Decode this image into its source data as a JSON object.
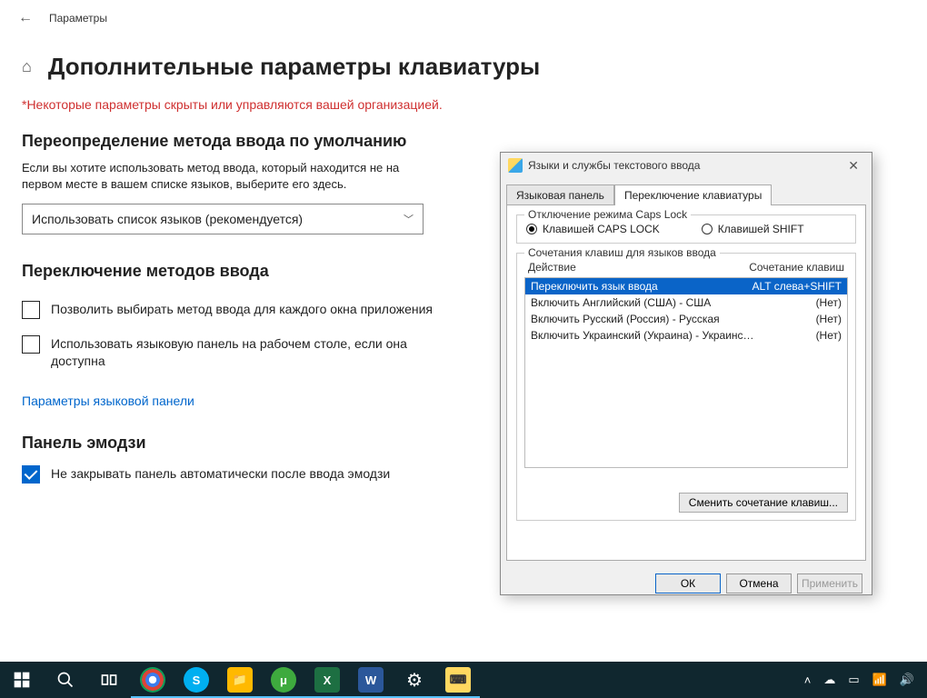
{
  "topbar": {
    "title": "Параметры"
  },
  "page": {
    "title": "Дополнительные параметры клавиатуры",
    "warning": "*Некоторые параметры скрыты или управляются вашей организацией.",
    "override": {
      "heading": "Переопределение метода ввода по умолчанию",
      "text": "Если вы хотите использовать метод ввода, который находится не на первом месте в вашем списке языков, выберите его здесь.",
      "dropdown_value": "Использовать список языков (рекомендуется)"
    },
    "switching": {
      "heading": "Переключение методов ввода",
      "cb1": "Позволить выбирать метод ввода для каждого окна приложения",
      "cb2": "Использовать языковую панель на рабочем столе, если она доступна",
      "link": "Параметры языковой панели"
    },
    "emoji": {
      "heading": "Панель эмодзи",
      "cb": "Не закрывать панель автоматически после ввода эмодзи"
    }
  },
  "dialog": {
    "title": "Языки и службы текстового ввода",
    "tabs": {
      "lang_panel": "Языковая панель",
      "kbd_switch": "Переключение клавиатуры"
    },
    "capslock": {
      "group_title": "Отключение режима Caps Lock",
      "radio_caps": "Клавишей CAPS LOCK",
      "radio_shift": "Клавишей SHIFT"
    },
    "shortcuts": {
      "group_title": "Сочетания клавиш для языков ввода",
      "col_action": "Действие",
      "col_combo": "Сочетание клавиш",
      "rows": [
        {
          "action": "Переключить язык ввода",
          "combo": "ALT слева+SHIFT"
        },
        {
          "action": "Включить Английский (США) - США",
          "combo": "(Нет)"
        },
        {
          "action": "Включить Русский (Россия) - Русская",
          "combo": "(Нет)"
        },
        {
          "action": "Включить Украинский (Украина) - Украинская (расшир...",
          "combo": "(Нет)"
        }
      ],
      "change_btn": "Сменить сочетание клавиш..."
    },
    "buttons": {
      "ok": "ОК",
      "cancel": "Отмена",
      "apply": "Применить"
    }
  }
}
